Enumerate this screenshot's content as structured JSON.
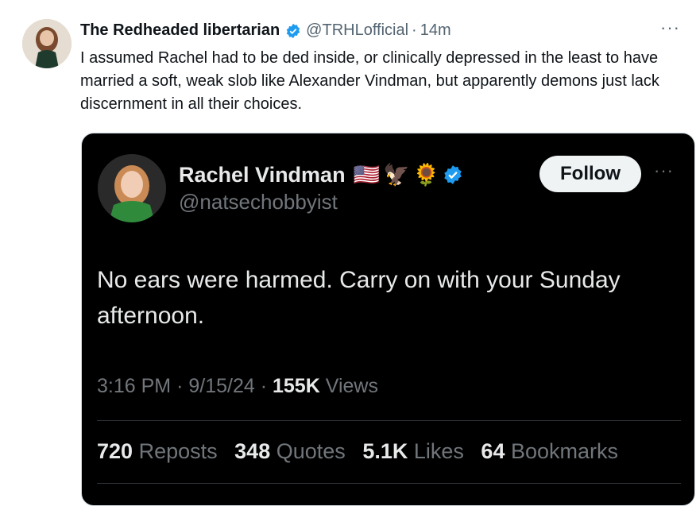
{
  "tweet": {
    "author_name": "The Redheaded libertarian",
    "author_handle": "@TRHLofficial",
    "separator": "·",
    "time": "14m",
    "more": "···",
    "text": "I assumed Rachel had to be ded inside, or clinically depressed in the least to have married a soft, weak slob like Alexander Vindman, but apparently demons just lack discernment in all their choices."
  },
  "quoted": {
    "author_name": "Rachel Vindman",
    "emojis": [
      "🇺🇸",
      "🦅",
      "🌻"
    ],
    "author_handle": "@natsechobbyist",
    "follow_label": "Follow",
    "more": "···",
    "text": "No ears were harmed. Carry on with your Sunday afternoon.",
    "time": "3:16 PM",
    "date": "9/15/24",
    "views_count": "155K",
    "views_label": "Views",
    "sep": "·",
    "reposts_count": "720",
    "reposts_label": "Reposts",
    "quotes_count": "348",
    "quotes_label": "Quotes",
    "likes_count": "5.1K",
    "likes_label": "Likes",
    "bookmarks_count": "64",
    "bookmarks_label": "Bookmarks"
  },
  "colors": {
    "verified": "#1d9bf0",
    "card_bg": "#000000"
  }
}
